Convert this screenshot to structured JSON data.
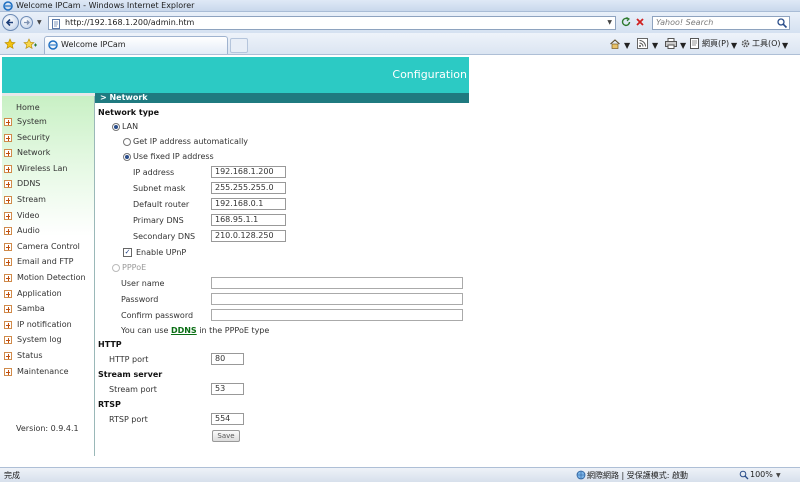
{
  "window": {
    "title": "Welcome IPCam - Windows Internet Explorer"
  },
  "addressbar": {
    "url": "http://192.168.1.200/admin.htm",
    "search_placeholder": "Yahoo! Search"
  },
  "tabs": {
    "active_label": "Welcome IPCam",
    "page_menu": "網頁(P)",
    "tools_menu": "工具(O)"
  },
  "banner": {
    "title": "Configuration"
  },
  "section": {
    "title": "> Network"
  },
  "sidebar": {
    "home": "Home",
    "items": [
      "System",
      "Security",
      "Network",
      "Wireless Lan",
      "DDNS",
      "Stream",
      "Video",
      "Audio",
      "Camera Control",
      "Email and FTP",
      "Motion Detection",
      "Application",
      "Samba",
      "IP notification",
      "System log",
      "Status",
      "Maintenance"
    ],
    "version": "Version: 0.9.4.1"
  },
  "form": {
    "network_type_heading": "Network type",
    "lan_label": "LAN",
    "auto_ip_label": "Get IP address automatically",
    "fixed_ip_label": "Use fixed IP address",
    "ip_address_label": "IP address",
    "ip_address_value": "192.168.1.200",
    "subnet_label": "Subnet mask",
    "subnet_value": "255.255.255.0",
    "router_label": "Default router",
    "router_value": "192.168.0.1",
    "dns1_label": "Primary DNS",
    "dns1_value": "168.95.1.1",
    "dns2_label": "Secondary DNS",
    "dns2_value": "210.0.128.250",
    "upnp_label": "Enable UPnP",
    "pppoe_label": "PPPoE",
    "username_label": "User name",
    "username_value": "",
    "password_label": "Password",
    "password_value": "",
    "confirm_label": "Confirm password",
    "confirm_value": "",
    "ddns_note_pre": "You can use",
    "ddns_link": "DDNS",
    "ddns_note_post": "in the PPPoE type",
    "http_heading": "HTTP",
    "http_port_label": "HTTP port",
    "http_port_value": "80",
    "stream_heading": "Stream server",
    "stream_port_label": "Stream port",
    "stream_port_value": "53",
    "rtsp_heading": "RTSP",
    "rtsp_port_label": "RTSP port",
    "rtsp_port_value": "554",
    "save_label": "Save"
  },
  "statusbar": {
    "status": "完成",
    "zone": "網際網路 | 受保護模式: 啟動",
    "zoom": "100%"
  },
  "colors": {
    "banner": "#2ccac4",
    "section_bar": "#1f7a80",
    "link": "#0a6e14"
  }
}
